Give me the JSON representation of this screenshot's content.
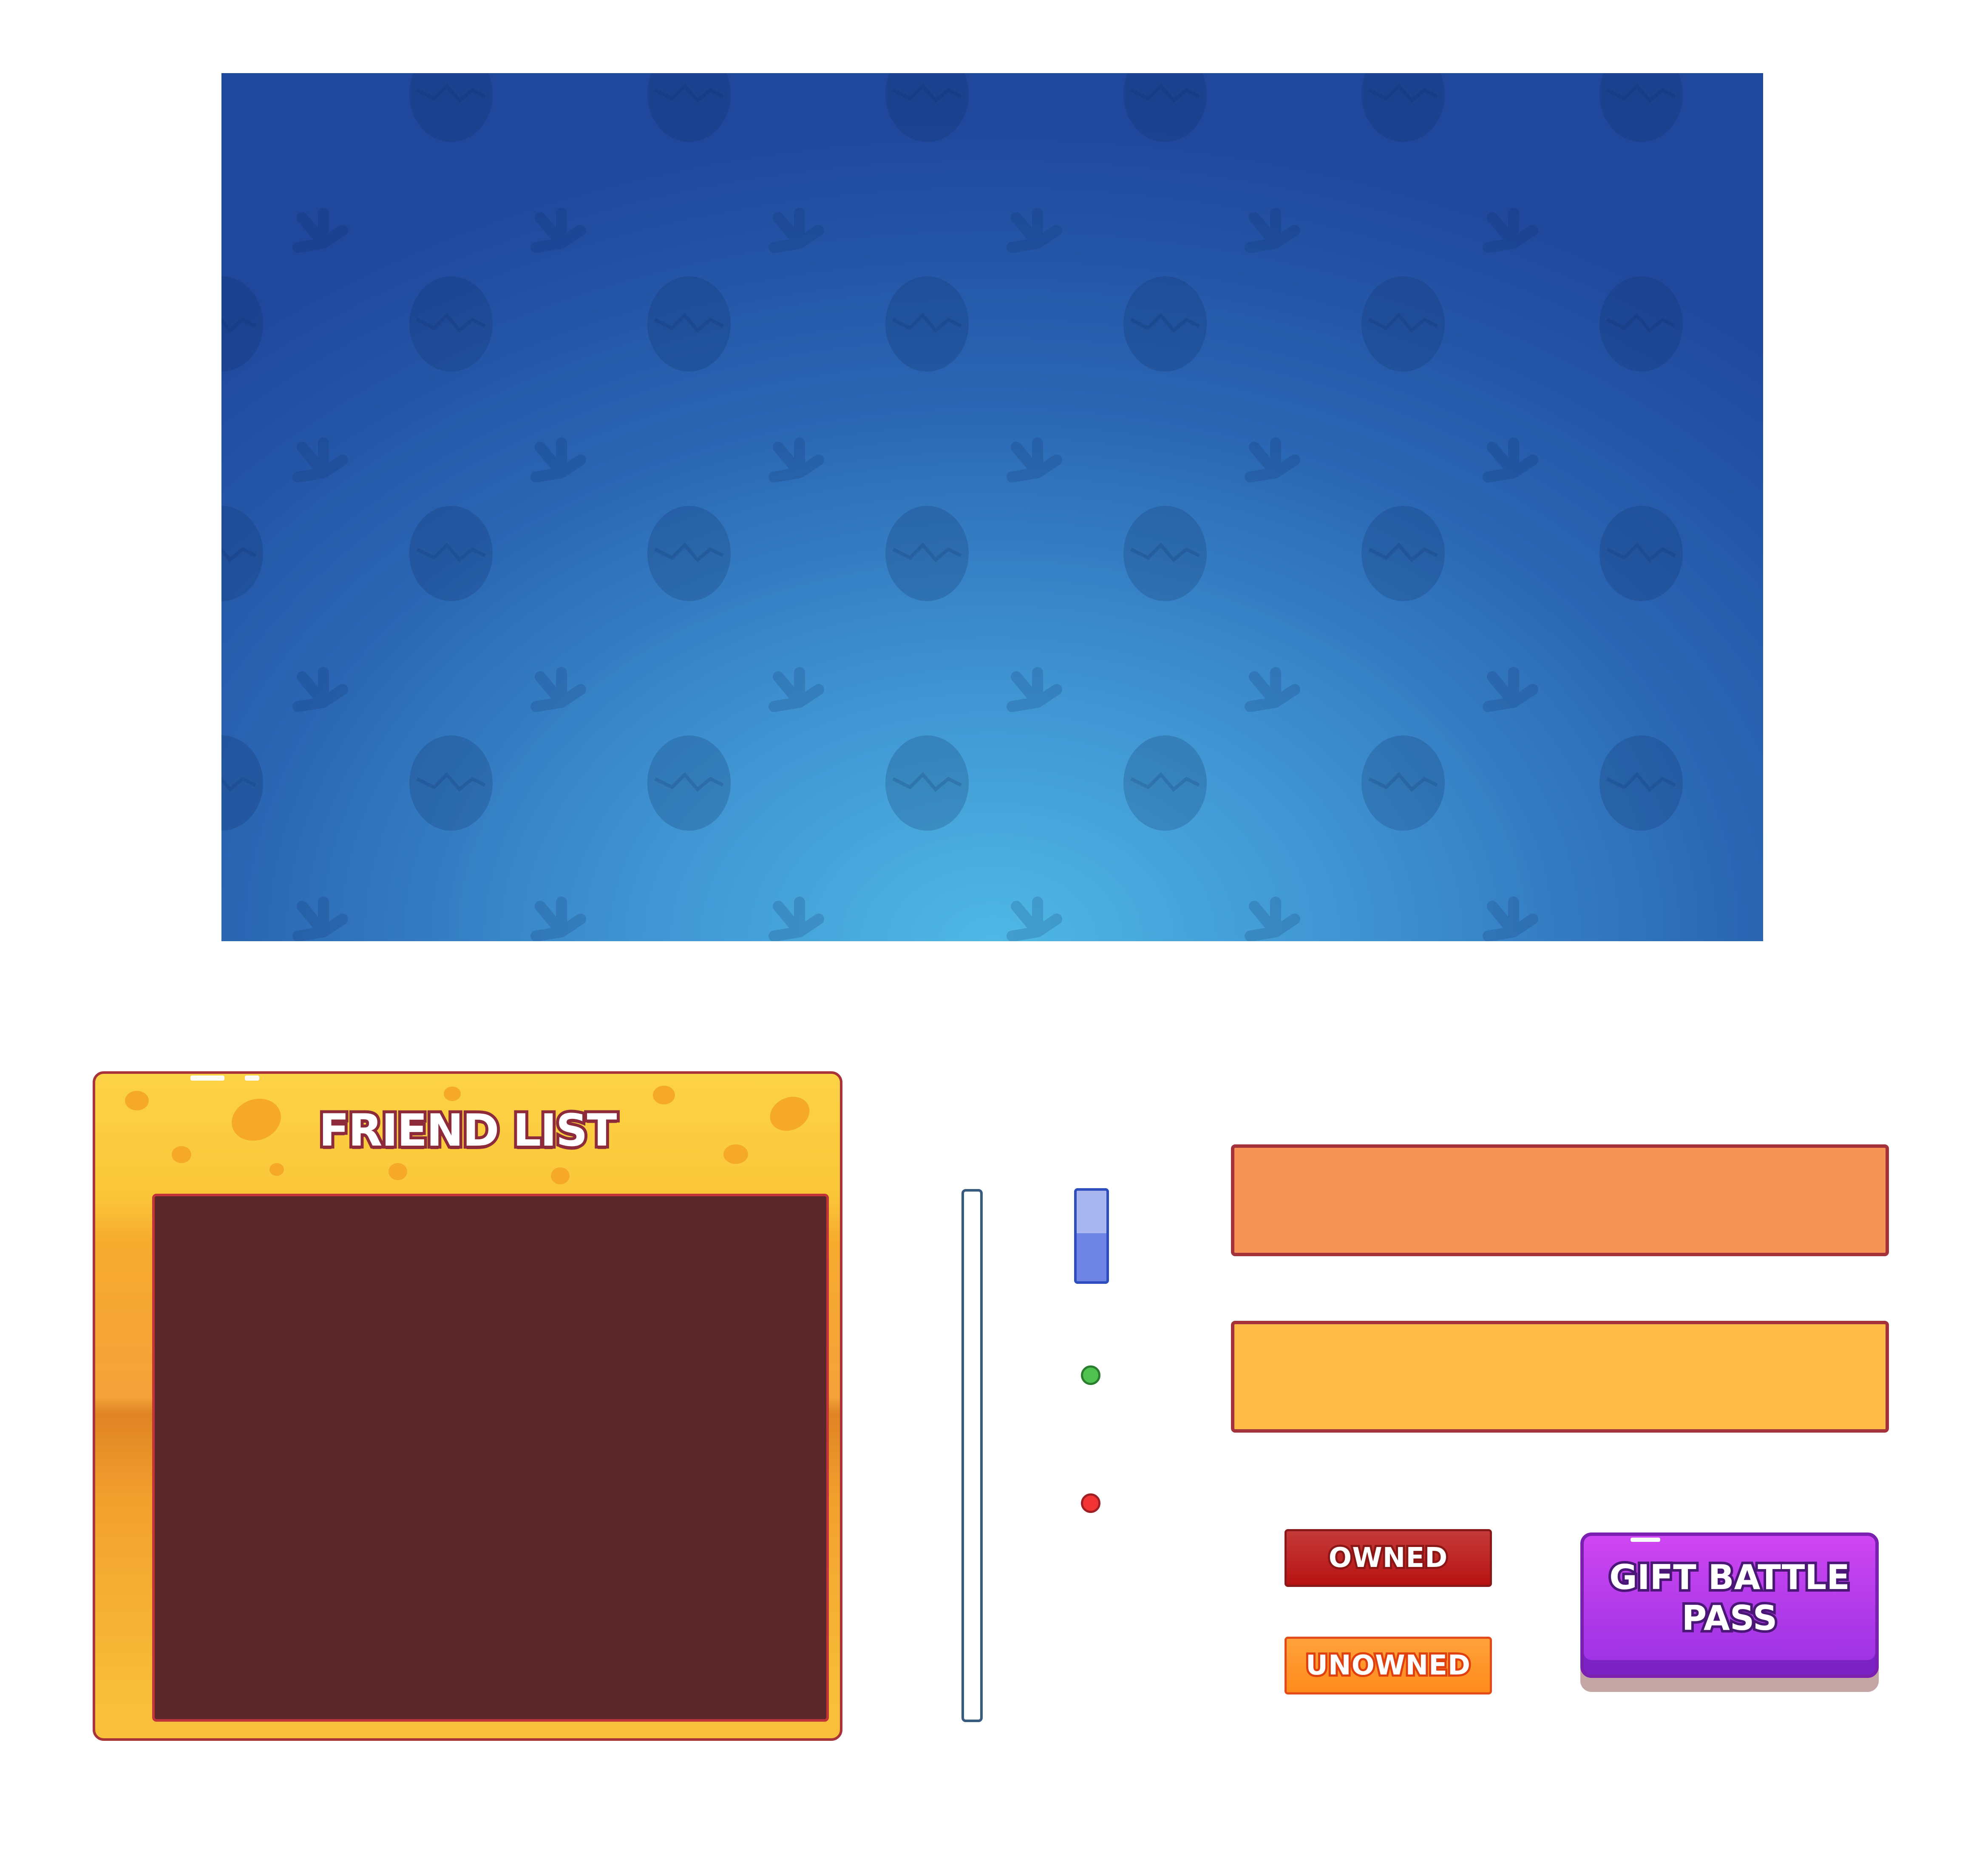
{
  "friend_list": {
    "title": "FRIEND LIST"
  },
  "labels": {
    "owned": "OWNED",
    "unowned": "UNOWNED"
  },
  "gift_button": {
    "label_line1": "GIFT BATTLE",
    "label_line2": "PASS"
  },
  "scrollbar": {
    "thumb_position": 0
  },
  "status": {
    "online": "green",
    "offline": "red"
  },
  "colors": {
    "banner_center": "#4fb8e6",
    "banner_edge": "#1f479c",
    "panel_gold": "#fcd246",
    "panel_inner": "#5b272b",
    "bar_orange": "#f69356",
    "bar_yellow": "#ffbb47",
    "owned": "#b71212",
    "unowned": "#ff8a1c",
    "gift": "#b03ae9"
  },
  "icons": {
    "background_pattern": [
      "egg-icon",
      "dino-footprint-icon"
    ]
  }
}
